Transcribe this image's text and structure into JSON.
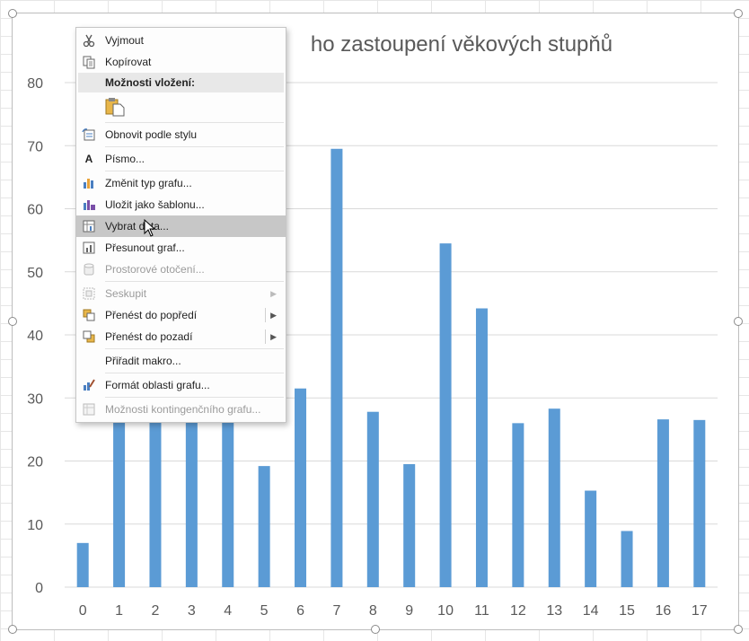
{
  "chart_data": {
    "type": "bar",
    "title": "…ho zastoupení věkových stupňů",
    "title_visible": "ho zastoupení věkových stupňů",
    "categories": [
      "0",
      "1",
      "2",
      "3",
      "4",
      "5",
      "6",
      "7",
      "8",
      "9",
      "10",
      "11",
      "12",
      "13",
      "14",
      "15",
      "16",
      "17"
    ],
    "series": [
      {
        "values": [
          7,
          30,
          30,
          30,
          30,
          19.2,
          31.5,
          69.5,
          27.8,
          19.5,
          54.5,
          44.2,
          26,
          28.3,
          15.3,
          8.9,
          26.6,
          26.5
        ]
      }
    ],
    "ylim": [
      0,
      80
    ],
    "yticks": [
      "0",
      "10",
      "20",
      "30",
      "40",
      "50",
      "60",
      "70",
      "80"
    ],
    "grid": true,
    "bar_color": "#5b9bd5"
  },
  "menu": {
    "items": [
      {
        "key": "cut",
        "label": "Vyjmout",
        "icon": "scissors-icon",
        "disabled": false
      },
      {
        "key": "copy",
        "label": "Kopírovat",
        "icon": "copy-icon",
        "disabled": false
      },
      {
        "key": "paste_header",
        "label": "Možnosti vložení:",
        "type": "header"
      },
      {
        "key": "reset_style",
        "label": "Obnovit podle stylu",
        "icon": "reset-style-icon",
        "disabled": false
      },
      {
        "key": "font",
        "label": "Písmo...",
        "icon": "font-icon",
        "disabled": false
      },
      {
        "key": "change_type",
        "label": "Změnit typ grafu...",
        "icon": "chart-type-icon",
        "disabled": false
      },
      {
        "key": "save_template",
        "label": "Uložit jako šablonu...",
        "icon": "template-icon",
        "disabled": false
      },
      {
        "key": "select_data",
        "label": "Vybrat data...",
        "icon": "select-data-icon",
        "disabled": false,
        "highlighted": true
      },
      {
        "key": "move_chart",
        "label": "Přesunout graf...",
        "icon": "move-chart-icon",
        "disabled": false
      },
      {
        "key": "rotation",
        "label": "Prostorové otočení...",
        "icon": "rotation-icon",
        "disabled": true
      },
      {
        "key": "group",
        "label": "Seskupit",
        "icon": "group-icon",
        "disabled": true,
        "submenu": true
      },
      {
        "key": "bring_front",
        "label": "Přenést do popředí",
        "icon": "bring-front-icon",
        "disabled": false,
        "submenu": true
      },
      {
        "key": "send_back",
        "label": "Přenést do pozadí",
        "icon": "send-back-icon",
        "disabled": false,
        "submenu": true
      },
      {
        "key": "macro",
        "label": "Přiřadit makro...",
        "disabled": false
      },
      {
        "key": "format_area",
        "label": "Formát oblasti grafu...",
        "icon": "format-area-icon",
        "disabled": false
      },
      {
        "key": "pivot",
        "label": "Možnosti kontingenčního grafu...",
        "icon": "pivot-icon",
        "disabled": true
      }
    ]
  },
  "colors": {
    "accent": "#5b9bd5",
    "highlight": "#c7c7c7"
  }
}
